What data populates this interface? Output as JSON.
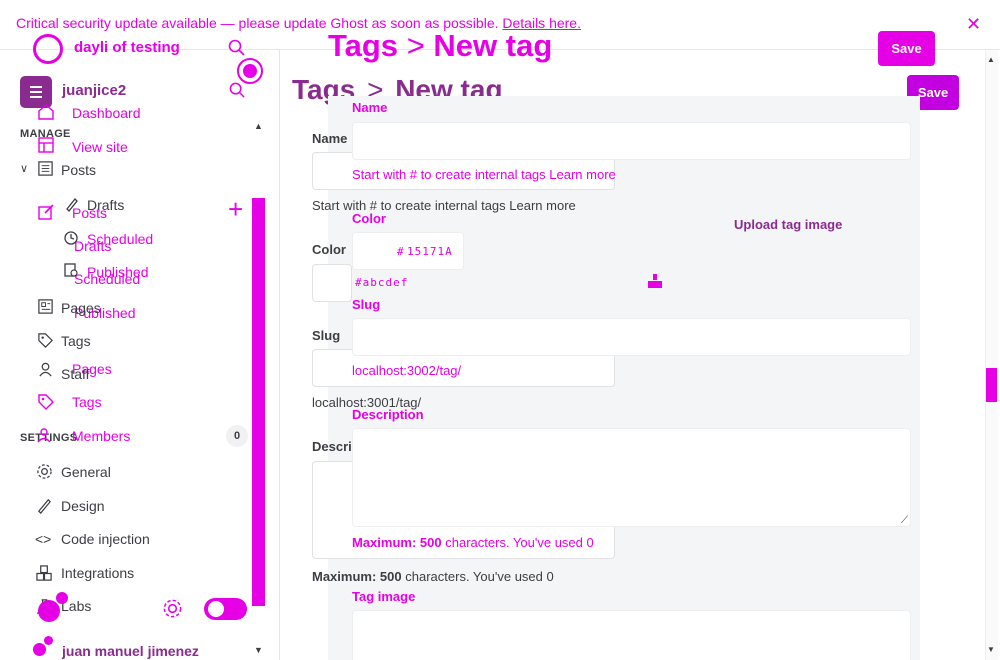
{
  "notice": {
    "text": "Critical security update available — please update Ghost as soon as possible.",
    "link": "Details here."
  },
  "site": {
    "title": "dayli of testing",
    "name": "juanjice2"
  },
  "overlay_title": {
    "section": "Tags",
    "sep": ">",
    "current": "New tag",
    "save": "Save"
  },
  "sidebar": {
    "manage_header": "MANAGE",
    "settings_header": "SETTINGS",
    "ghost": {
      "dashboard": "Dashboard",
      "view_site": "View site",
      "posts": "Posts",
      "drafts": "Drafts",
      "scheduled": "Scheduled",
      "published": "Published",
      "pages": "Pages",
      "tags": "Tags",
      "members": "Members",
      "members_count": "0"
    },
    "manage": {
      "posts": "Posts",
      "drafts": "Drafts",
      "scheduled": "Scheduled",
      "published": "Published",
      "pages": "Pages",
      "tags": "Tags",
      "staff": "Staff"
    },
    "settings": {
      "general": "General",
      "design": "Design",
      "code_injection": "Code injection",
      "integrations": "Integrations",
      "labs": "Labs"
    },
    "user": "juan manuel jimenez"
  },
  "header": {
    "section": "Tags",
    "sep": ">",
    "current": "New tag",
    "save": "Save"
  },
  "form": {
    "name_label": "Name",
    "name_hint": "Start with # to create internal tags",
    "learn_more": "Learn more",
    "color_label": "Color",
    "color_value": "15171A",
    "color_placeholder": "#abcdef",
    "slug_label": "Slug",
    "slug_hint_back": "localhost:3001/tag/",
    "slug_hint_front": "localhost:3002/tag/",
    "description_label": "Description",
    "desc_max_label": "Maximum:",
    "desc_max_num": "500",
    "desc_max_rest": "characters. You've used",
    "desc_used": "0",
    "tag_image_label": "Tag image",
    "upload_label": "Upload tag image"
  },
  "colors": {
    "accent": "#e600e6",
    "brand_dark": "#8a2b8f",
    "text": "#3d3d44"
  }
}
